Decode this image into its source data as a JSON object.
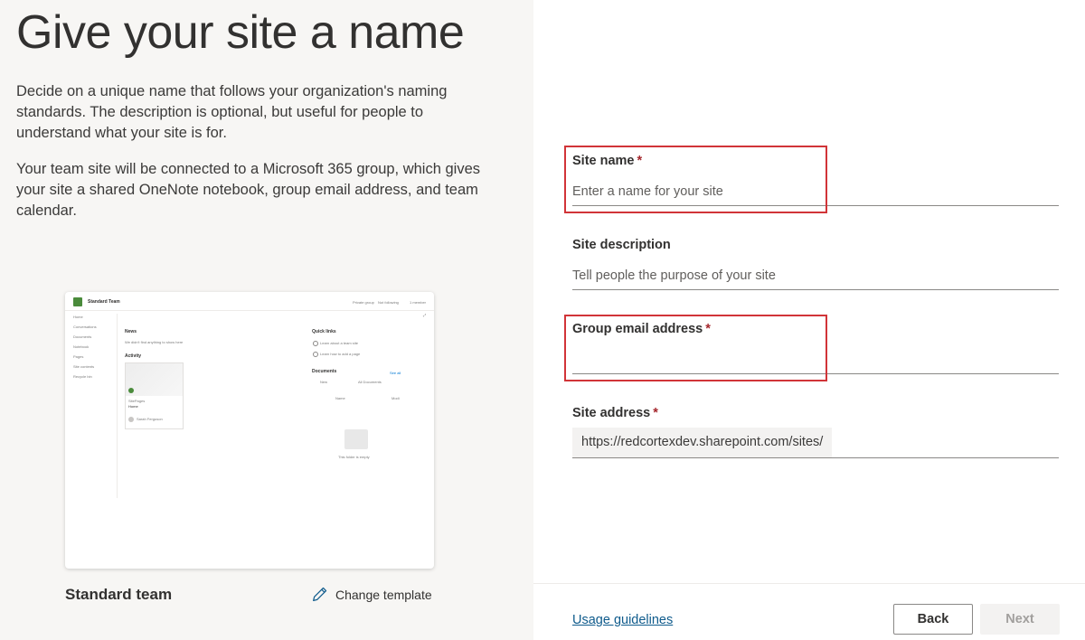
{
  "left": {
    "title": "Give your site a name",
    "description_1": "Decide on a unique name that follows your organization's naming standards. The description is optional, but useful for people to understand what your site is for.",
    "description_2": "Your team site will be connected to a Microsoft 365 group, which gives your site a shared OneNote notebook, group email address, and team calendar.",
    "template_name": "Standard team",
    "change_template_label": "Change template",
    "preview": {
      "site_title": "Standard Team",
      "header_actions": [
        "Private group",
        "Not following",
        "1 member"
      ],
      "nav_items": [
        "Home",
        "Conversations",
        "Documents",
        "Notebook",
        "Pages",
        "Site contents",
        "Recycle bin"
      ],
      "news_heading": "News",
      "news_text": "We didn't find anything to show here",
      "activity_heading": "Activity",
      "activity_card_title": "SitePages",
      "activity_card_sub": "Home",
      "activity_person": "Sarah Ferguson",
      "quick_links_heading": "Quick links",
      "quick_links": [
        "Learn about a team site",
        "Learn how to add a page"
      ],
      "documents_heading": "Documents",
      "see_all": "See all",
      "doc_new": "New",
      "doc_view": "All Documents",
      "col_name": "Name",
      "col_modified": "Modi",
      "empty_text": "This folder is empty"
    }
  },
  "form": {
    "site_name": {
      "label": "Site name",
      "required": "*",
      "placeholder": "Enter a name for your site",
      "value": ""
    },
    "site_description": {
      "label": "Site description",
      "placeholder": "Tell people the purpose of your site",
      "value": ""
    },
    "group_email": {
      "label": "Group email address",
      "required": "*",
      "value": ""
    },
    "site_address": {
      "label": "Site address",
      "required": "*",
      "prefix": "https://redcortexdev.sharepoint.com/sites/"
    }
  },
  "footer": {
    "usage_link": "Usage guidelines",
    "back_label": "Back",
    "next_label": "Next"
  },
  "colors": {
    "left_bg": "#f7f6f4",
    "highlight_border": "#d13438",
    "required_asterisk": "#a4262c",
    "link": "#0f5b8c",
    "site_logo": "#4a8b3b"
  },
  "icons": {
    "change_template": "pencil-icon"
  }
}
